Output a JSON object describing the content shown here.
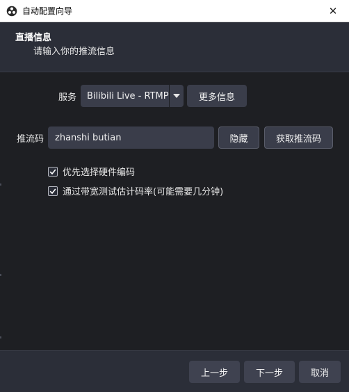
{
  "window": {
    "title": "自动配置向导",
    "close_glyph": "✕"
  },
  "header": {
    "title": "直播信息",
    "subtitle": "请输入你的推流信息"
  },
  "service": {
    "label": "服务",
    "selected": "Bilibili Live - RTMP",
    "more_info_label": "更多信息"
  },
  "stream_key": {
    "label": "推流码",
    "value": "zhanshi butian",
    "hide_label": "隐藏",
    "get_key_label": "获取推流码"
  },
  "options": [
    {
      "label": "优先选择硬件编码",
      "checked": true
    },
    {
      "label": "通过带宽测试估计码率(可能需要几分钟)",
      "checked": true
    }
  ],
  "footer": {
    "prev_label": "上一步",
    "next_label": "下一步",
    "cancel_label": "取消"
  },
  "colors": {
    "background": "#1e1f23",
    "panel": "#2b2e38",
    "control": "#3a3d4a",
    "titlebar": "#ffffff"
  }
}
